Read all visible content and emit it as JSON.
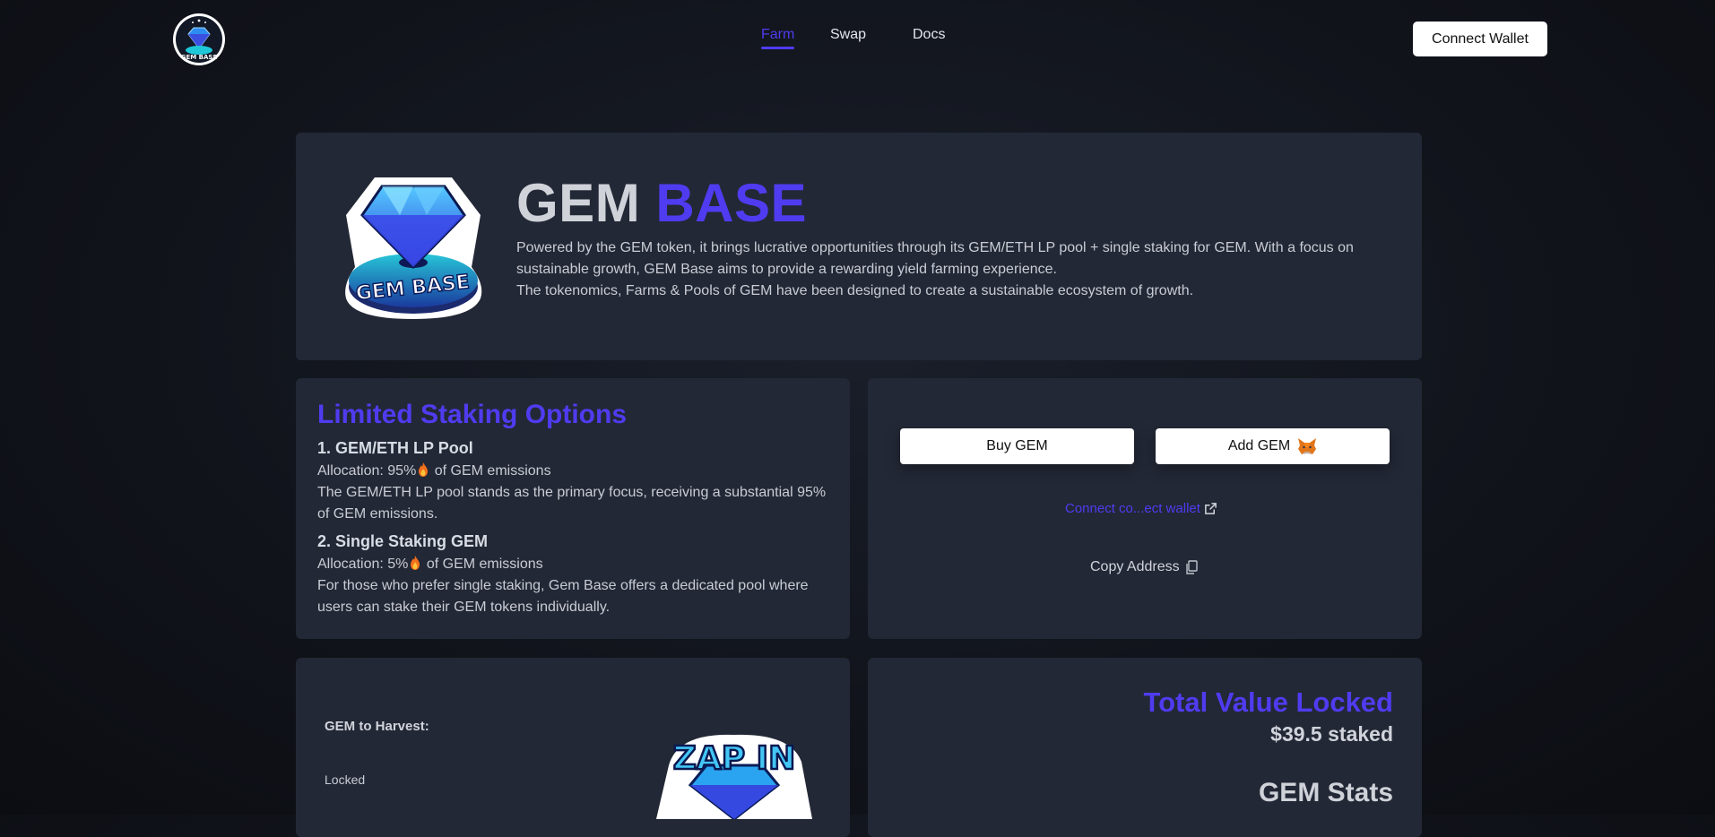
{
  "nav": {
    "links": [
      {
        "label": "Farm",
        "active": true
      },
      {
        "label": "Swap",
        "active": false
      },
      {
        "label": "Docs",
        "active": false
      }
    ],
    "connect_label": "Connect Wallet"
  },
  "hero": {
    "title_part1": "GEM",
    "title_part2": "BASE",
    "desc_line1": "Powered by the GEM token, it brings lucrative opportunities through its GEM/ETH LP pool + single staking for GEM. With a focus on",
    "desc_line2": "sustainable growth, GEM Base aims to provide a rewarding yield farming experience.",
    "desc_line3": "The tokenomics, Farms & Pools of GEM have been designed to create a sustainable ecosystem of growth."
  },
  "staking": {
    "title": "Limited Staking Options",
    "pool1": {
      "heading": "1. GEM/ETH LP Pool",
      "allocation_prefix": "Allocation: 95%",
      "allocation_suffix": "of GEM emissions",
      "description": "The GEM/ETH LP pool stands as the primary focus, receiving a substantial 95% of GEM emissions."
    },
    "pool2": {
      "heading": "2. Single Staking GEM",
      "allocation_prefix": "Allocation: 5%",
      "allocation_suffix": "of GEM emissions",
      "description": "For those who prefer single staking, Gem Base offers a dedicated pool where users can stake their GEM tokens individually."
    }
  },
  "actions": {
    "buy_label": "Buy GEM",
    "add_label": "Add GEM",
    "connect_link": "Connect co...ect wallet",
    "copy_label": "Copy Address"
  },
  "harvest": {
    "label": "GEM to Harvest:",
    "locked": "Locked"
  },
  "tvl": {
    "title": "Total Value Locked",
    "value": "$39.5 staked",
    "stats_title": "GEM Stats"
  },
  "colors": {
    "accent": "#4f3cf0",
    "card": "#232836",
    "background": "#11141b"
  },
  "icons": [
    "gem-base-logo",
    "flame-icon",
    "metamask-fox-icon",
    "external-link-icon",
    "copy-icon",
    "zap-in-logo"
  ]
}
